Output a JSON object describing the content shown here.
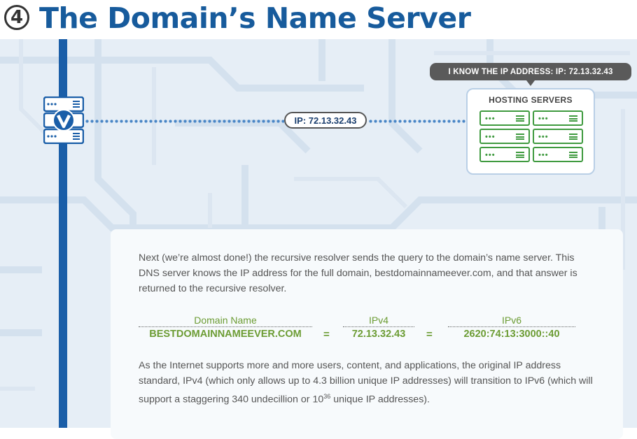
{
  "header": {
    "step_number": "4",
    "title": "The Domain’s Name Server"
  },
  "connection": {
    "ip_label": "IP: 72.13.32.43"
  },
  "callout": {
    "text": "I KNOW THE IP ADDRESS: IP: 72.13.32.43"
  },
  "hosting": {
    "title": "HOSTING SERVERS",
    "server_count": 6
  },
  "content": {
    "paragraph1": "Next (we’re almost done!) the recursive resolver sends the query to the domain’s name server. This DNS server knows the IP address for the full domain, bestdomainnameever.com, and that answer is returned to the recursive resolver.",
    "table": {
      "headers": [
        "Domain Name",
        "IPv4",
        "IPv6"
      ],
      "values": [
        "BESTDOMAINNAMEEVER.COM",
        "72.13.32.43",
        "2620:74:13:3000::40"
      ],
      "separator": "="
    },
    "paragraph2_main": "As the Internet supports more and more users, content, and applications, the original IP address standard, IPv4 (which only allows up to 4.3 billion unique IP addresses) will transition to IPv6 (which will support a staggering 340 undecillion or 10",
    "paragraph2_exp": "36",
    "paragraph2_end": " unique IP addresses)."
  },
  "colors": {
    "title_blue": "#175b9c",
    "line_blue": "#1a5ea8",
    "server_green": "#3f9a3f",
    "table_green": "#6c9c34",
    "background": "#e6eef6"
  },
  "icons": {
    "resolver": "resolver-server-icon",
    "hosting_server": "server-icon"
  }
}
